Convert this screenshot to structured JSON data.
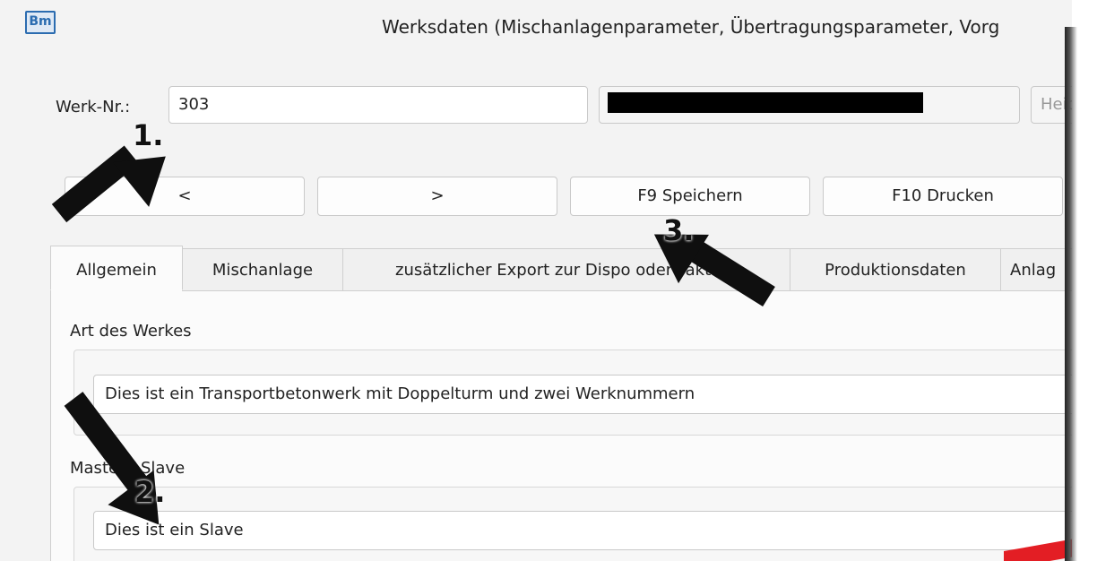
{
  "window": {
    "title": "Werksdaten (Mischanlagenparameter, Übertragungsparameter, Vorg",
    "app_icon_text": "Bm"
  },
  "header": {
    "werk_nr_label": "Werk-Nr.:",
    "werk_nr_value": "303",
    "placeholder_field": "Heid"
  },
  "toolbar": {
    "prev_label": "<",
    "next_label": ">",
    "save_label": "F9 Speichern",
    "print_label": "F10 Drucken"
  },
  "tabs": [
    {
      "label": "Allgemein",
      "active": true
    },
    {
      "label": "Mischanlage"
    },
    {
      "label": "zusätzlicher Export zur Dispo oder Faktura"
    },
    {
      "label": "Produktionsdaten"
    },
    {
      "label": "Anlag"
    }
  ],
  "general": {
    "art_label": "Art des Werkes",
    "art_value": "Dies ist ein Transportbetonwerk mit Doppelturm und zwei Werknummern",
    "master_slave_label": "Master / Slave",
    "master_slave_value": "Dies ist ein Slave"
  },
  "annotations": {
    "step1": "1.",
    "step2": "2.",
    "step3": "3."
  },
  "colors": {
    "arrow": "#0f0f0f",
    "accent_red": "#e31e24",
    "window_bg": "#f3f3f3"
  }
}
